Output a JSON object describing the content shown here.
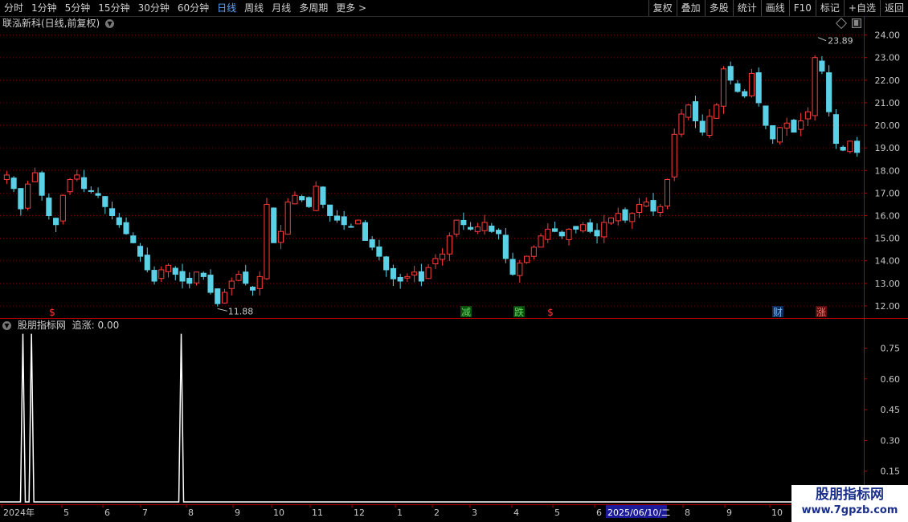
{
  "toolbar": {
    "periods": [
      "分时",
      "1分钟",
      "5分钟",
      "15分钟",
      "30分钟",
      "60分钟",
      "日线",
      "周线",
      "月线",
      "多周期",
      "更多 >"
    ],
    "active_period": "日线",
    "right_buttons": [
      "复权",
      "叠加",
      "多股",
      "统计",
      "画线",
      "F10",
      "标记",
      "+自选",
      "返回"
    ]
  },
  "main_title": "联泓新科(日线,前复权)",
  "indicator_title": "股朋指标网",
  "indicator_value_label": "追涨: 0.00",
  "watermark": {
    "line1": "股朋指标网",
    "line2": "www.7gpzb.com"
  },
  "colors": {
    "up": "#ff3b3b",
    "down": "#5ad1e6",
    "grid": "#7a0000",
    "axis": "#b40000",
    "indicator": "#ffffff",
    "highlight_box": "#1b1b9a"
  },
  "chart_data": [
    {
      "type": "candlestick",
      "title": "联泓新科(日线,前复权)",
      "y_ticks": [
        12.0,
        13.0,
        14.0,
        15.0,
        16.0,
        17.0,
        18.0,
        19.0,
        20.0,
        21.0,
        22.0,
        23.0,
        24.0
      ],
      "ylim": [
        11.5,
        24.2
      ],
      "max_marker": {
        "label": "23.89",
        "value": 23.89
      },
      "min_marker": {
        "label": "11.88",
        "value": 11.88
      },
      "x_ticks": [
        "2024年",
        "5",
        "6",
        "7",
        "8",
        "9",
        "10",
        "11",
        "12",
        "1",
        "2",
        "3",
        "4",
        "5",
        "6",
        "2025/06/10/二",
        "8",
        "9",
        "10"
      ],
      "event_markers": [
        "$",
        "减",
        "跌",
        "$",
        "财",
        "涨"
      ],
      "close_trend": [
        17.8,
        17.2,
        16.3,
        17.4,
        17.9,
        16.9,
        16.0,
        15.6,
        16.9,
        17.6,
        17.8,
        17.2,
        17.1,
        16.9,
        16.4,
        16.0,
        15.6,
        15.2,
        14.8,
        14.2,
        13.6,
        13.1,
        13.6,
        13.8,
        13.4,
        13.1,
        13.0,
        13.5,
        13.3,
        12.6,
        12.1,
        12.6,
        13.1,
        13.4,
        13.0,
        12.7,
        13.3,
        16.5,
        14.8,
        15.3,
        16.6,
        16.9,
        16.7,
        16.4,
        17.3,
        16.5,
        16.0,
        15.8,
        15.6,
        15.5,
        15.8,
        14.9,
        14.6,
        14.2,
        13.6,
        13.2,
        13.1,
        13.3,
        13.5,
        13.1,
        13.7,
        14.1,
        14.3,
        15.1,
        15.8,
        15.6,
        15.4,
        15.5,
        15.7,
        15.3,
        15.2,
        14.1,
        13.4,
        13.9,
        14.2,
        14.6,
        15.1,
        15.4,
        15.3,
        15.1,
        15.4,
        15.4,
        15.6,
        15.3,
        15.1,
        15.7,
        15.9,
        16.1,
        15.8,
        16.1,
        16.5,
        16.6,
        16.2,
        16.4,
        17.6,
        19.6,
        20.5,
        20.9,
        20.2,
        19.7,
        20.4,
        20.9,
        22.5,
        22.0,
        21.5,
        21.3,
        22.3,
        21.0,
        20.0,
        19.4,
        19.9,
        20.1,
        19.7,
        20.2,
        20.6,
        23.0,
        22.4,
        20.6,
        19.2,
        18.9,
        19.3,
        18.8
      ],
      "up_color": "#ff3b3b",
      "down_color": "#5ad1e6"
    },
    {
      "type": "line",
      "title": "股朋指标网",
      "series_label": "追涨: 0.00",
      "y_ticks": [
        0.15,
        0.3,
        0.45,
        0.6,
        0.75
      ],
      "ylim": [
        0,
        0.85
      ],
      "pulses": [
        {
          "at": 0.023,
          "value": 0.82
        },
        {
          "at": 0.033,
          "value": 0.82
        },
        {
          "at": 0.208,
          "value": 0.82
        }
      ],
      "line_color": "#ffffff"
    }
  ]
}
